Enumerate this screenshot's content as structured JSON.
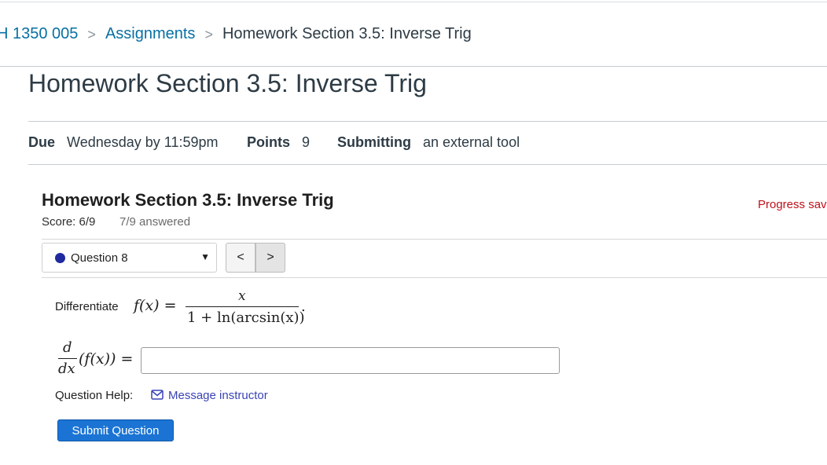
{
  "breadcrumb": {
    "course": "H 1350 005",
    "assignments": "Assignments",
    "current": "Homework Section 3.5: Inverse Trig",
    "separator": ">"
  },
  "page": {
    "title": "Homework Section 3.5: Inverse Trig"
  },
  "details": {
    "due_label": "Due",
    "due_value": "Wednesday by 11:59pm",
    "points_label": "Points",
    "points_value": "9",
    "submitting_label": "Submitting",
    "submitting_value": "an external tool"
  },
  "tool": {
    "title": "Homework Section 3.5: Inverse Trig",
    "progress": "Progress sav",
    "score": "Score: 6/9",
    "answered": "7/9 answered",
    "question_select": "Question 8",
    "caret": "▼",
    "prev_icon": "<",
    "next_icon": ">",
    "status_color": "#1f2a9f"
  },
  "question": {
    "prompt": "Differentiate",
    "fx": "f(x) =",
    "numerator": "x",
    "denominator": "1 + ln(arcsin(x))",
    "period": ".",
    "deriv_top": "d",
    "deriv_bottom": "dx",
    "deriv_rest": "(f(x)) =",
    "answer_value": "",
    "help_label": "Question Help:",
    "help_link": "Message instructor",
    "submit_label": "Submit Question"
  },
  "colors": {
    "link": "#0770a3",
    "submit": "#1b74d4",
    "progress": "#c0101a"
  }
}
